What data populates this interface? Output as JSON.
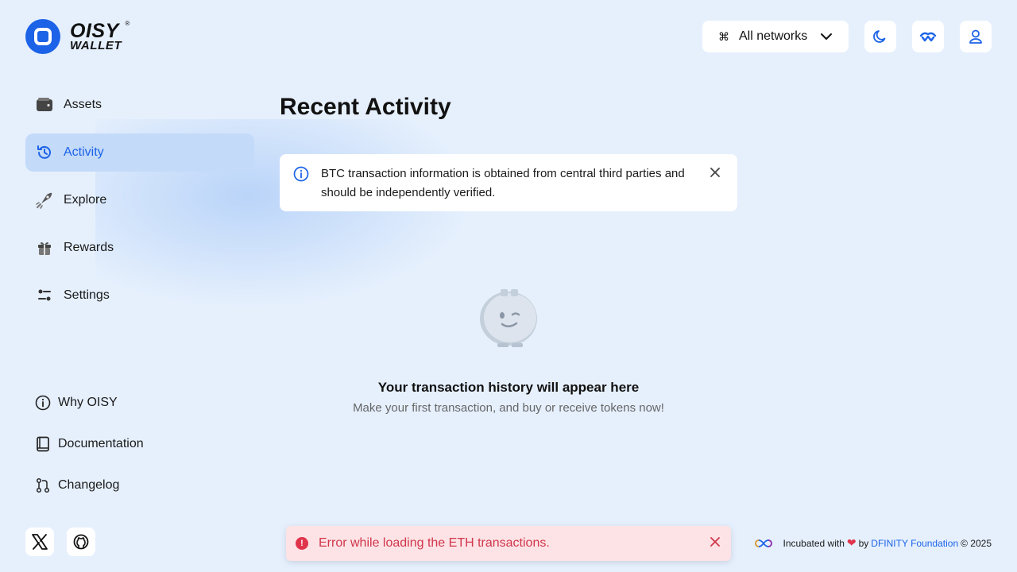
{
  "logo": {
    "line1": "OISY",
    "line2": "WALLET",
    "reg": "®"
  },
  "header": {
    "network_label": "All networks",
    "colors": {
      "accent": "#1c63e8",
      "bg": "#e6f0fd"
    }
  },
  "nav": {
    "items": [
      {
        "label": "Assets",
        "icon": "wallet-icon"
      },
      {
        "label": "Activity",
        "icon": "history-icon",
        "active": true
      },
      {
        "label": "Explore",
        "icon": "rocket-icon"
      },
      {
        "label": "Rewards",
        "icon": "gift-icon"
      },
      {
        "label": "Settings",
        "icon": "sliders-icon"
      }
    ]
  },
  "links": {
    "items": [
      {
        "label": "Why OISY",
        "icon": "info-icon"
      },
      {
        "label": "Documentation",
        "icon": "book-icon"
      },
      {
        "label": "Changelog",
        "icon": "git-pull-request-icon"
      }
    ]
  },
  "main": {
    "title": "Recent Activity",
    "info_text": "BTC transaction information is obtained from central third parties and should be independently verified.",
    "empty_title": "Your transaction history will appear here",
    "empty_subtitle": "Make your first transaction, and buy or receive tokens now!"
  },
  "toast": {
    "text": "Error while loading the ETH transactions."
  },
  "footer": {
    "prefix": "Incubated with",
    "by": "by",
    "org": "DFINITY Foundation",
    "copyright": "© 2025"
  }
}
